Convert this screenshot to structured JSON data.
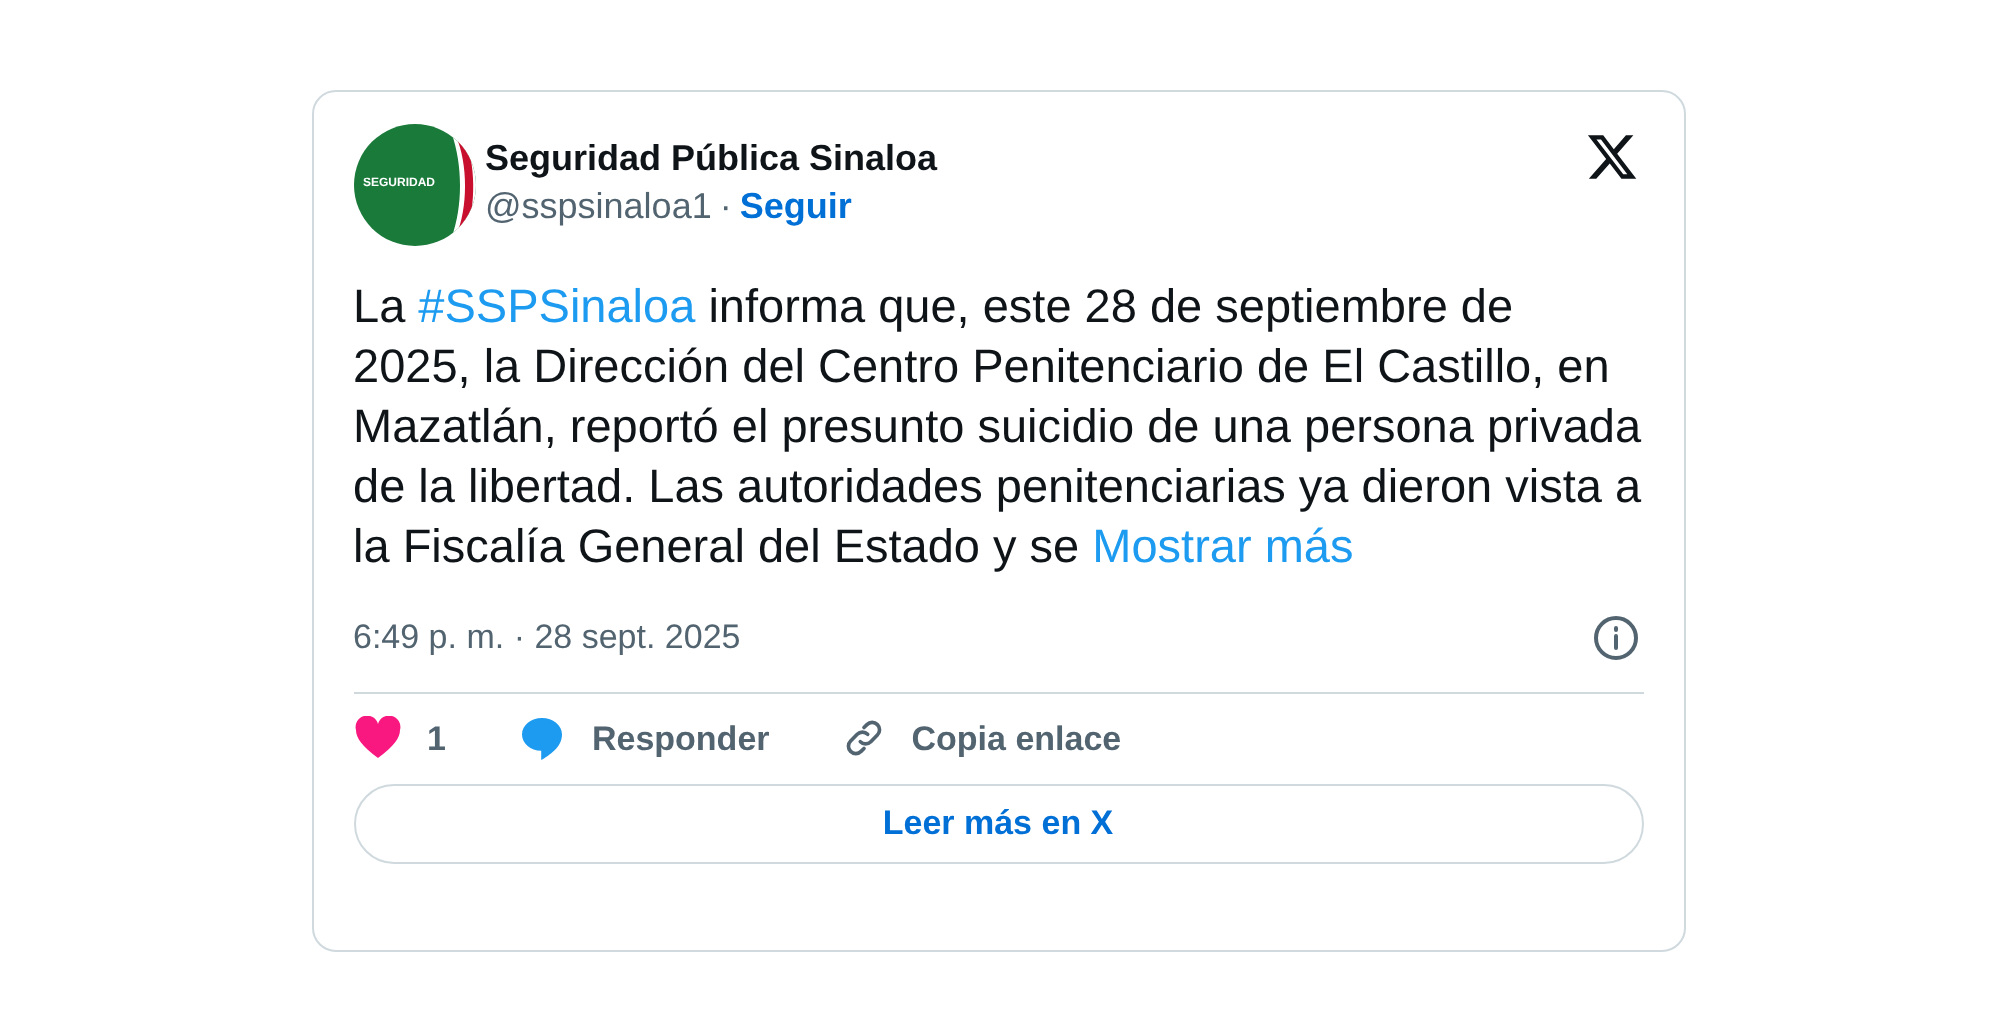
{
  "author": {
    "avatar_label": "SEGURIDAD",
    "name": "Seguridad Pública Sinaloa",
    "handle": "@sspsinaloa1",
    "separator": "·",
    "follow": "Seguir"
  },
  "body": {
    "before": "La ",
    "hashtag": "#SSPSinaloa",
    "text": " informa que, este 28 de septiembre de 2025, la Dirección del Centro Penitenciario de El Castillo, en Mazatlán, reportó el presunto suicidio de una persona privada de la libertad. Las autoridades penitenciarias ya dieron vista a la Fiscalía General del Estado y se ",
    "more": "Mostrar más"
  },
  "timestamp": "6:49 p. m. · 28 sept. 2025",
  "actions": [
    {
      "kind": "like",
      "label": "1"
    },
    {
      "kind": "reply",
      "label": "Responder"
    },
    {
      "kind": "copy",
      "label": "Copia enlace"
    }
  ],
  "read_more": "Leer más en X"
}
